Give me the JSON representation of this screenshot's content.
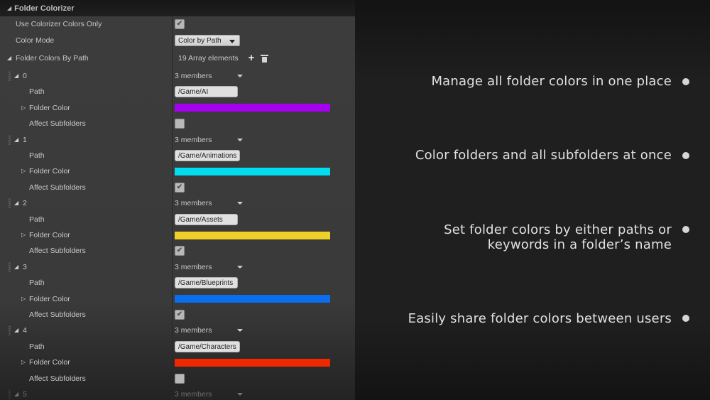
{
  "panel": {
    "category_title": "Folder Colorizer",
    "use_colorizer_label": "Use Colorizer Colors Only",
    "use_colorizer_checked": true,
    "color_mode_label": "Color Mode",
    "color_mode_value": "Color by Path",
    "folder_colors_label": "Folder Colors By Path",
    "array_count": "19 Array elements",
    "add_icon": "plus-icon",
    "delete_icon": "trash-icon",
    "field_labels": {
      "path": "Path",
      "folder_color": "Folder Color",
      "affect_subfolders": "Affect Subfolders"
    },
    "elements": [
      {
        "index": "0",
        "members": "3 members",
        "path": "/Game/AI",
        "color": "#a600f0",
        "affect_subfolders": false
      },
      {
        "index": "1",
        "members": "3 members",
        "path": "/Game/Animations",
        "color": "#00dcf0",
        "affect_subfolders": true
      },
      {
        "index": "2",
        "members": "3 members",
        "path": "/Game/Assets",
        "color": "#f0d028",
        "affect_subfolders": true
      },
      {
        "index": "3",
        "members": "3 members",
        "path": "/Game/Blueprints",
        "color": "#0a6ef0",
        "affect_subfolders": true
      },
      {
        "index": "4",
        "members": "3 members",
        "path": "/Game/Characters",
        "color": "#f02800",
        "affect_subfolders": false
      },
      {
        "index": "5",
        "members": "3 members"
      }
    ]
  },
  "features": [
    {
      "text": "Manage all folder colors in one place"
    },
    {
      "text": "Color folders and all subfolders at once"
    },
    {
      "text": "Set folder colors by either paths or\nkeywords in a folder’s name"
    },
    {
      "text": "Easily share folder colors between users"
    }
  ],
  "check_glyph": "✔"
}
